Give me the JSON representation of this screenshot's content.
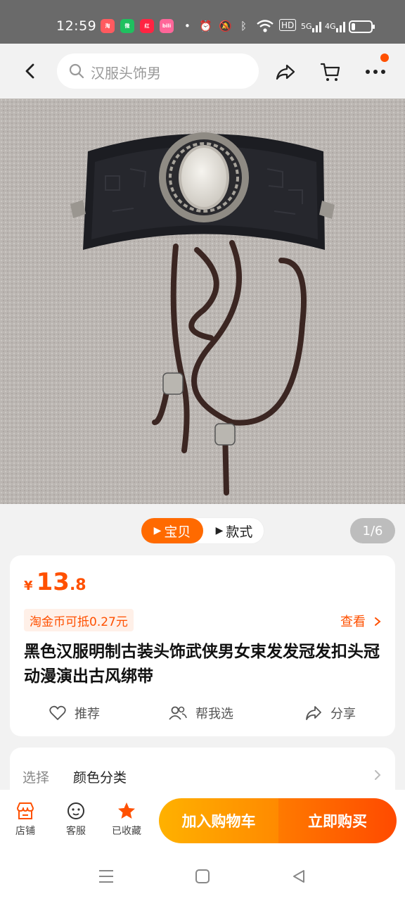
{
  "status_bar": {
    "time": "12:59",
    "apps": [
      {
        "name": "taobao-app-icon",
        "color": "#ff5a5f",
        "text": "淘"
      },
      {
        "name": "wechat-app-icon",
        "color": "#1fc05f",
        "text": "微"
      },
      {
        "name": "xiaohongshu-app-icon",
        "color": "#ff2442",
        "text": "小红书"
      },
      {
        "name": "bilibili-app-icon",
        "color": "#ff6699",
        "text": "bili"
      }
    ],
    "hd_label": "HD",
    "net1": "5G",
    "net2": "4G"
  },
  "header": {
    "search_placeholder": "汉服头饰男"
  },
  "gallery": {
    "tab_active": "宝贝",
    "tab_inactive": "款式",
    "counter": "1/6"
  },
  "product": {
    "currency": "¥",
    "price_int": "13",
    "price_dec": ".8",
    "coin_text": "淘金币可抵0.27元",
    "view_label": "查看",
    "title": "黑色汉服明制古装头饰武侠男女束发发冠发扣头冠动漫演出古风绑带",
    "actions": {
      "recommend": "推荐",
      "help_choose": "帮我选",
      "share": "分享"
    }
  },
  "options": {
    "label": "选择",
    "value": "颜色分类"
  },
  "bottom_bar": {
    "store": "店铺",
    "service": "客服",
    "favorited": "已收藏",
    "add_to_cart": "加入购物车",
    "buy_now": "立即购买"
  },
  "colors": {
    "accent": "#ff5000",
    "cart_gradient_start": "#ffb100",
    "buy_gradient_end": "#ff4a00"
  }
}
